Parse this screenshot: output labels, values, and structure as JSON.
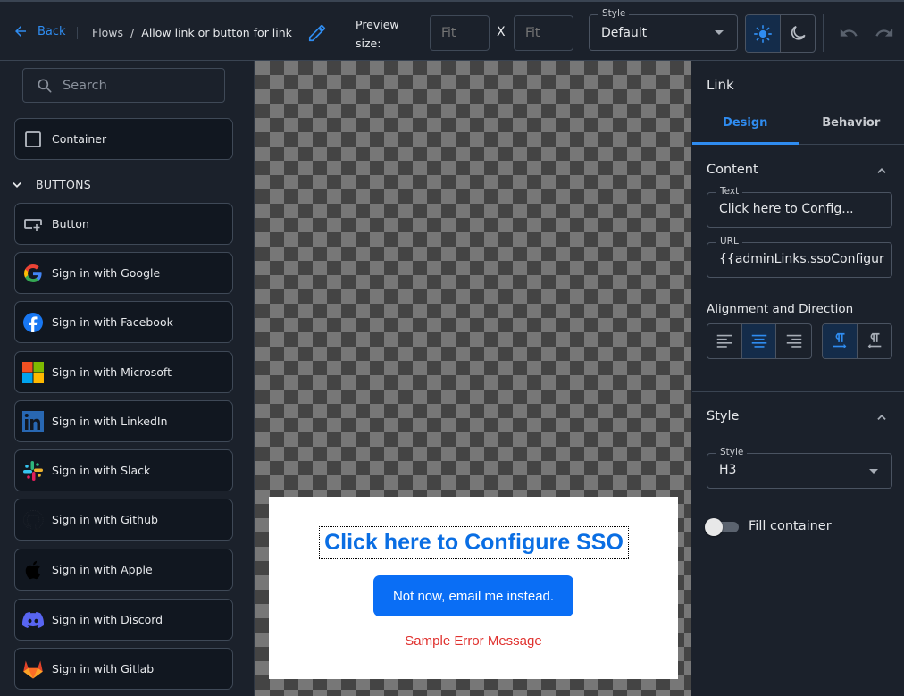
{
  "topbar": {
    "back_label": "Back",
    "breadcrumb": {
      "root": "Flows",
      "separator": "/",
      "current": "Allow link or button for link"
    },
    "preview_size_label": "Preview size:",
    "width_placeholder": "Fit",
    "height_placeholder": "Fit",
    "size_separator": "X",
    "style_select": {
      "legend": "Style",
      "value": "Default"
    },
    "theme": {
      "active": "light",
      "options": [
        "light",
        "dark"
      ]
    },
    "accent_color": "#2f8cf0"
  },
  "sidebar": {
    "search_placeholder": "Search",
    "container_label": "Container",
    "section_buttons": "BUTTONS",
    "items": [
      {
        "label": "Button",
        "icon": "button-icon"
      },
      {
        "label": "Sign in with Google",
        "icon": "google-icon"
      },
      {
        "label": "Sign in with Facebook",
        "icon": "facebook-icon"
      },
      {
        "label": "Sign in with Microsoft",
        "icon": "microsoft-icon"
      },
      {
        "label": "Sign in with LinkedIn",
        "icon": "linkedin-icon"
      },
      {
        "label": "Sign in with Slack",
        "icon": "slack-icon"
      },
      {
        "label": "Sign in with Github",
        "icon": "github-icon"
      },
      {
        "label": "Sign in with Apple",
        "icon": "apple-icon"
      },
      {
        "label": "Sign in with Discord",
        "icon": "discord-icon"
      },
      {
        "label": "Sign in with Gitlab",
        "icon": "gitlab-icon"
      }
    ]
  },
  "canvas": {
    "link_text": "Click here to Configure SSO",
    "button_text": "Not now, email me instead.",
    "error_text": "Sample Error Message",
    "link_color": "#0a6ee3",
    "button_color": "#0a6ef5",
    "error_color": "#e0312e"
  },
  "panel": {
    "title": "Link",
    "tabs": [
      {
        "label": "Design",
        "active": true
      },
      {
        "label": "Behavior",
        "active": false
      }
    ],
    "content_section": "Content",
    "text_field": {
      "legend": "Text",
      "value": "Click here to Config..."
    },
    "url_field": {
      "legend": "URL",
      "value": "{{adminLinks.ssoConfigur"
    },
    "alignment_label": "Alignment and Direction",
    "alignment": {
      "selected": "center",
      "options": [
        "left",
        "center",
        "right"
      ]
    },
    "direction": {
      "selected": "ltr",
      "options": [
        "ltr",
        "rtl"
      ]
    },
    "style_section": "Style",
    "style_field": {
      "legend": "Style",
      "value": "H3"
    },
    "fill_container": {
      "label": "Fill container",
      "on": false
    }
  }
}
